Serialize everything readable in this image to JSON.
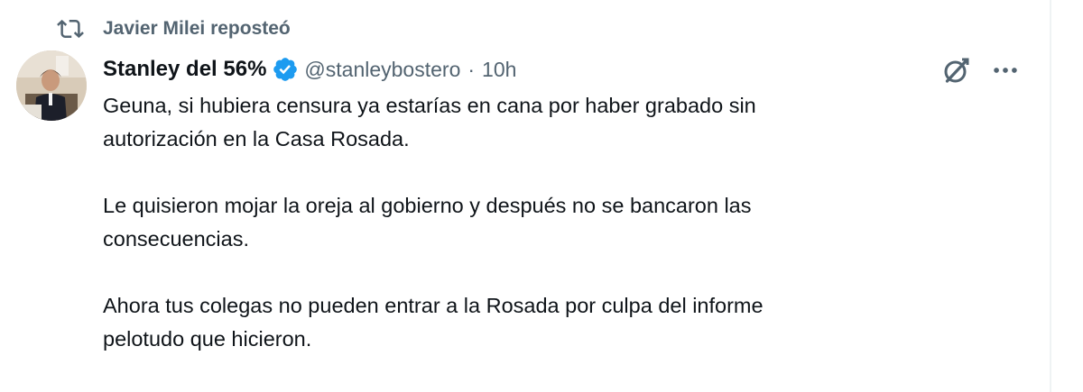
{
  "repost": {
    "icon": "repost-icon",
    "text": "Javier Milei reposteó"
  },
  "author": {
    "display_name": "Stanley del 56%",
    "verified_icon": "verified-badge-icon",
    "handle": "@stanleybostero",
    "separator": "·",
    "timestamp": "10h"
  },
  "actions": {
    "grok_icon": "grok-icon",
    "more_icon": "more-icon"
  },
  "tweet": {
    "paragraphs": [
      {
        "line1": "Geuna, si hubiera censura ya estarías en cana por haber grabado sin",
        "line2": "autorización en la Casa Rosada."
      },
      {
        "line1": "Le quisieron mojar la oreja al gobierno y después no se bancaron las",
        "line2": "consecuencias."
      },
      {
        "line1": "Ahora tus colegas no pueden entrar a la Rosada por culpa del informe",
        "line2": "pelotudo que hicieron."
      }
    ]
  },
  "colors": {
    "text_primary": "#0f1419",
    "text_secondary": "#536471",
    "verified": "#1d9bf0",
    "background": "#ffffff"
  }
}
